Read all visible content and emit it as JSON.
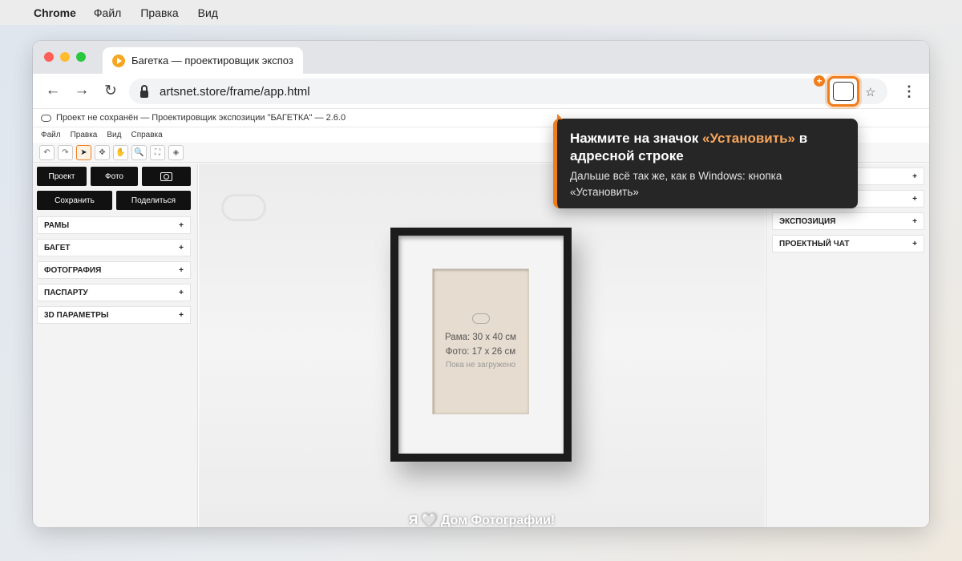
{
  "os_menubar": {
    "app": "Chrome",
    "items": [
      "Файл",
      "Правка",
      "Вид"
    ]
  },
  "browser": {
    "tab_title": "Багетка — проектировщик экспоз",
    "url": "artsnet.store/frame/app.html",
    "nav": {
      "back": "←",
      "forward": "→",
      "reload": "↻"
    },
    "install_badge": "+",
    "star": "☆",
    "menu": "⋮"
  },
  "app": {
    "title": "Проект не сохранён — Проектировщик экспозиции \"БАГЕТКА\" — 2.6.0",
    "menu": [
      "Файл",
      "Правка",
      "Вид",
      "Справка"
    ],
    "tools": [
      "↶",
      "↷",
      "➤",
      "✥",
      "✋",
      "🔍",
      "⛶",
      "◈"
    ],
    "left": {
      "buttons": {
        "project": "Проект",
        "photo": "Фото",
        "save": "Сохранить",
        "share": "Поделиться"
      },
      "sections": [
        "РАМЫ",
        "БАГЕТ",
        "ФОТОГРАФИЯ",
        "ПАСПАРТУ",
        "3D ПАРАМЕТРЫ"
      ],
      "plus": "+"
    },
    "canvas": {
      "frame_size": "Рама: 30 x 40 см",
      "photo_size": "Фото: 17 x 26 см",
      "status": "Пока не загружено",
      "slogan": "Я 🤍 Дом Фотографии!"
    },
    "right": {
      "sections": [
        "",
        "",
        "ЭКСПОЗИЦИЯ",
        "ПРОЕКТНЫЙ ЧАТ"
      ]
    }
  },
  "tooltip": {
    "title_pre": "Нажмите на значок ",
    "title_highlight": "«Установить»",
    "title_post": " в адресной строке",
    "body": "Дальше всё так же, как в Windows: кнопка «Установить»"
  },
  "colors": {
    "accent": "#f07d1c",
    "tooltip_bg": "#262626"
  }
}
